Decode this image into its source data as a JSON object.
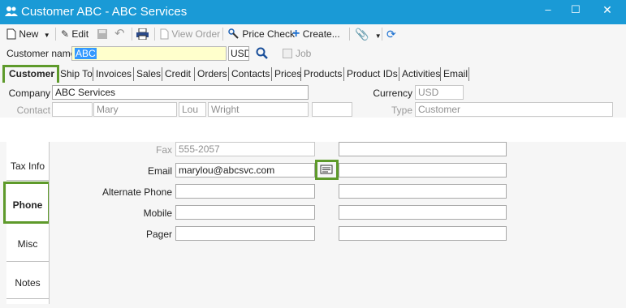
{
  "window": {
    "title": "Customer ABC - ABC Services",
    "controls": {
      "minimize": "–",
      "maximize": "☐",
      "close": "✕"
    }
  },
  "toolbar": {
    "new_label": "New",
    "edit_label": "Edit",
    "view_order_label": "View Order",
    "price_check_label": "Price Check",
    "create_label": "Create..."
  },
  "customer": {
    "name_label": "Customer name",
    "name_value": "ABC",
    "currency_code": "USD",
    "job_label": "Job"
  },
  "tabs": [
    "Customer",
    "Ship To",
    "Invoices",
    "Sales",
    "Credit",
    "Orders",
    "Contacts",
    "Prices",
    "Products",
    "Product IDs",
    "Activities",
    "Email"
  ],
  "active_tab": "Customer",
  "company": {
    "label": "Company",
    "value": "ABC Services",
    "currency_label": "Currency",
    "currency_value": "USD",
    "contact_label": "Contact",
    "contact_first": "Mary",
    "contact_middle": "Lou",
    "contact_last": "Wright",
    "type_label": "Type",
    "type_value": "Customer"
  },
  "side_tabs": [
    "Tax Info",
    "Phone",
    "Misc",
    "Notes"
  ],
  "active_side_tab": "Phone",
  "phone": {
    "fax_label": "Fax",
    "fax_value": "555-2057",
    "email_label": "Email",
    "email_value": "marylou@abcsvc.com",
    "alternate_phone_label": "Alternate Phone",
    "mobile_label": "Mobile",
    "pager_label": "Pager"
  },
  "colors": {
    "titlebar": "#1a9ad6",
    "highlight": "#5e9a2b",
    "selection": "#3399ff",
    "name_field_bg": "#ffffcc"
  }
}
